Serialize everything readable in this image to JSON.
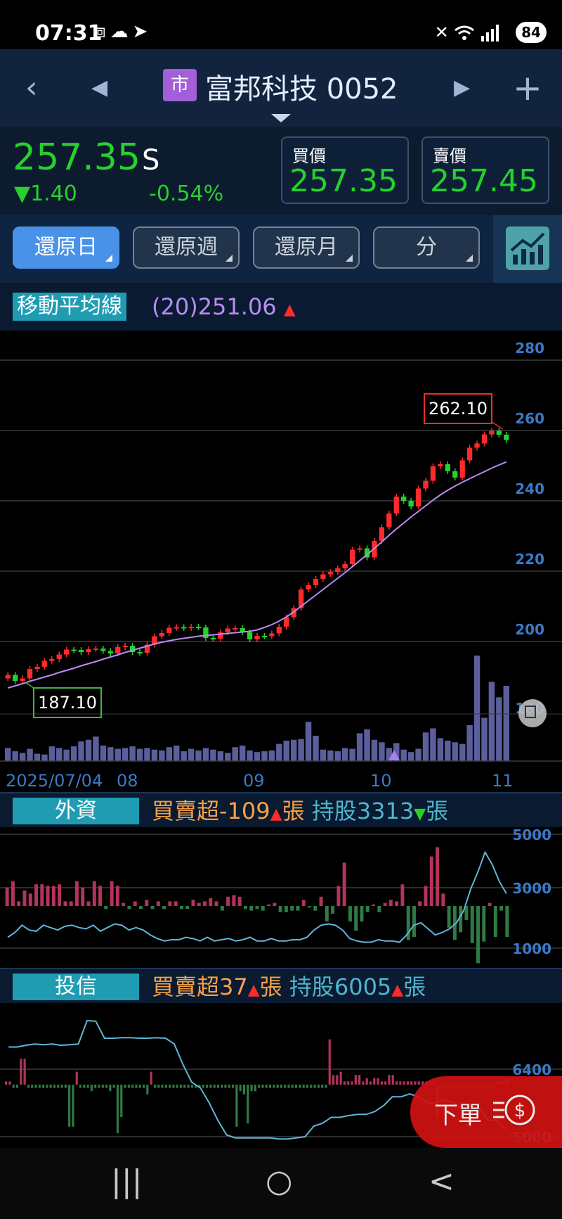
{
  "status_bar": {
    "time": "07:31",
    "left_icons": [
      "screenshot-icon",
      "cloud-icon",
      "navigation-icon"
    ],
    "right_icons": [
      "mute-icon",
      "wifi-icon",
      "signal-icon"
    ],
    "battery": "84"
  },
  "header": {
    "market_badge": "市",
    "title": "富邦科技 0052",
    "back_icon": "back-icon",
    "prev_icon": "prev-stock-icon",
    "next_icon": "next-stock-icon",
    "add_icon": "add-icon"
  },
  "quote": {
    "price": "257.35",
    "price_suffix": "S",
    "change": "▼1.40",
    "change_pct": "-0.54%",
    "bid_label": "買價",
    "bid": "257.35",
    "ask_label": "賣價",
    "ask": "257.45",
    "price_color": "#27d12b"
  },
  "periods": [
    {
      "label": "還原日",
      "active": true
    },
    {
      "label": "還原週",
      "active": false
    },
    {
      "label": "還原月",
      "active": false
    },
    {
      "label": "分",
      "active": false
    }
  ],
  "moving_average": {
    "label": "移動平均線",
    "value": "(20)251.06",
    "arrow": "▲",
    "line_color": "#b88cf2"
  },
  "chart_data": [
    {
      "type": "candlestick",
      "y_ticks": [
        "280",
        "260",
        "240",
        "220",
        "200"
      ],
      "ylim": [
        175,
        285
      ],
      "high_label": "262.10",
      "low_label": "187.10",
      "partial_tick": "180",
      "x_labels": [
        "2025/07/04",
        "08",
        "09",
        "10",
        "11"
      ],
      "up_color": "#ff2b2b",
      "down_color": "#27d12b",
      "close": [
        190.5,
        188.8,
        189.5,
        192.2,
        192.8,
        194.5,
        195.0,
        196.3,
        197.7,
        197.6,
        197.0,
        197.8,
        198.0,
        197.3,
        196.6,
        198.4,
        198.8,
        197.0,
        196.8,
        199.1,
        201.5,
        202.4,
        203.9,
        204.1,
        203.8,
        204.2,
        204.0,
        201.0,
        200.8,
        202.6,
        203.7,
        203.8,
        202.6,
        200.6,
        201.6,
        201.5,
        202.3,
        204.2,
        206.9,
        209.5,
        214.8,
        216.0,
        217.8,
        219.1,
        219.8,
        220.8,
        222.0,
        226.1,
        226.5,
        223.9,
        228.6,
        232.5,
        236.4,
        241.2,
        240.0,
        238.4,
        243.5,
        245.7,
        249.8,
        250.4,
        248.4,
        246.6,
        251.5,
        255.1,
        256.3,
        258.9,
        259.9,
        258.8,
        257.3
      ],
      "ma20": [
        186.8,
        187.4,
        188.0,
        188.7,
        189.3,
        189.9,
        190.5,
        191.2,
        191.8,
        192.4,
        193.1,
        193.7,
        194.3,
        195.0,
        195.6,
        196.2,
        196.9,
        197.5,
        198.1,
        198.7,
        199.3,
        199.8,
        200.2,
        200.6,
        200.9,
        201.2,
        201.5,
        201.7,
        201.9,
        202.1,
        202.3,
        202.5,
        202.7,
        202.9,
        203.3,
        204.0,
        204.8,
        205.8,
        207.0,
        208.4,
        210.0,
        211.6,
        213.2,
        214.8,
        216.4,
        218.0,
        219.6,
        221.3,
        223.0,
        224.7,
        226.5,
        228.3,
        230.2,
        232.0,
        233.7,
        235.4,
        237.0,
        238.6,
        240.2,
        241.7,
        243.0,
        244.2,
        245.3,
        246.3,
        247.3,
        248.3,
        249.3,
        250.2,
        251.06
      ],
      "volume": [
        1.6,
        1.2,
        1.0,
        1.5,
        0.9,
        0.8,
        1.8,
        1.6,
        1.4,
        1.8,
        2.4,
        2.6,
        3.0,
        1.9,
        1.7,
        1.5,
        1.6,
        1.8,
        1.5,
        1.6,
        1.4,
        1.3,
        1.7,
        1.9,
        1.2,
        1.5,
        1.3,
        1.6,
        1.4,
        1.2,
        1.0,
        1.7,
        1.9,
        1.3,
        1.1,
        1.2,
        1.3,
        2.1,
        2.5,
        2.6,
        2.7,
        4.8,
        3.1,
        1.4,
        1.3,
        1.2,
        1.6,
        1.5,
        3.4,
        3.9,
        2.6,
        2.3,
        1.6,
        2.2,
        1.4,
        1.1,
        1.5,
        3.5,
        4.0,
        2.8,
        2.5,
        2.3,
        2.1,
        4.4,
        12.9,
        5.3,
        9.7,
        7.8,
        9.2
      ]
    },
    {
      "type": "bar+line",
      "name": "外資",
      "y_ticks": [
        "5000",
        "3000",
        "1000"
      ],
      "ylim": [
        0,
        5500
      ],
      "bars": [
        12,
        16,
        3,
        10,
        8,
        14,
        14,
        13,
        13,
        14,
        3,
        3,
        16,
        12,
        3,
        16,
        13,
        -2,
        16,
        13,
        2,
        -2,
        3,
        -2,
        4,
        -2,
        3,
        -2,
        3,
        3,
        -2,
        -2,
        4,
        2,
        3,
        5,
        3,
        -3,
        6,
        7,
        6,
        -2,
        -3,
        -2,
        -3,
        1,
        2,
        -4,
        -4,
        -3,
        -3,
        4,
        -1,
        -3,
        6,
        -10,
        -5,
        13,
        28,
        -10,
        -16,
        -10,
        -4,
        1,
        -4,
        2,
        4,
        3,
        14,
        -22,
        -20,
        3,
        13,
        32,
        38,
        8,
        -14,
        -22,
        -17,
        -9,
        -24,
        -37,
        -23,
        2,
        -20,
        -3,
        -20
      ],
      "holdings": [
        1200,
        1400,
        1700,
        1500,
        1450,
        1700,
        1600,
        1500,
        1650,
        1700,
        1600,
        1550,
        1700,
        1450,
        1600,
        1750,
        1700,
        1500,
        1600,
        1500,
        1300,
        1150,
        1050,
        1100,
        1100,
        1200,
        1150,
        1050,
        1200,
        1050,
        1100,
        1150,
        1050,
        1100,
        1200,
        1050,
        1050,
        1150,
        1050,
        1050,
        1100,
        1100,
        1200,
        1500,
        1700,
        1750,
        1700,
        1500,
        1150,
        1050,
        1000,
        1000,
        1100,
        1050,
        1050,
        1000,
        1300,
        1700,
        1800,
        1550,
        1300,
        1400,
        1550,
        1800,
        2300,
        3200,
        3900,
        4700,
        4200,
        3500,
        3000
      ]
    },
    {
      "type": "bar+line",
      "name": "投信",
      "y_ticks": [
        "6400",
        "5000"
      ],
      "ylim": [
        4800,
        7200
      ],
      "bars": [
        1,
        1,
        -1,
        -1,
        8,
        8,
        -1,
        -1,
        -1,
        -1,
        -1,
        -1,
        -1,
        -1,
        -1,
        -1,
        -1,
        -13,
        -13,
        4,
        -1,
        -1,
        -1,
        -2,
        -1,
        -1,
        -1,
        -1,
        -2,
        -1,
        -15,
        -10,
        -1,
        -1,
        -1,
        -1,
        -1,
        -1,
        -3,
        4,
        -1,
        -1,
        -1,
        -1,
        -1,
        -1,
        -1,
        -1,
        -1,
        -1,
        -1,
        -1,
        -1,
        -1,
        -1,
        -1,
        -1,
        -1,
        -1,
        -1,
        -1,
        -1,
        -13,
        -2,
        -3,
        -12,
        -2,
        -2,
        -1,
        -1,
        -1,
        -1,
        -1,
        -1,
        -1,
        -1,
        -1,
        -1,
        -1,
        -1,
        -1,
        -1,
        -1,
        -1,
        -1,
        -1,
        -1,
        14,
        3,
        3,
        4,
        1,
        1,
        1,
        3,
        3,
        1,
        2,
        1,
        2,
        2,
        1,
        1,
        3,
        3,
        1,
        1,
        1,
        1,
        1,
        1,
        1,
        1,
        1,
        1,
        1,
        -10,
        -1,
        -1,
        -1,
        -1,
        -1,
        -1,
        -1,
        -1,
        -1,
        -1,
        -1,
        -1,
        -1,
        -1,
        -1,
        1,
        1,
        1,
        2
      ],
      "holdings": [
        6450,
        6450,
        6480,
        6500,
        6490,
        6500,
        6480,
        6490,
        6500,
        6900,
        6890,
        6600,
        6600,
        6610,
        6610,
        6600,
        6600,
        6610,
        6600,
        6500,
        6150,
        5850,
        5750,
        5500,
        5200,
        4950,
        4900,
        4900,
        4900,
        4900,
        4900,
        4880,
        4880,
        4900,
        4920,
        5100,
        5150,
        5250,
        5250,
        5280,
        5300,
        5300,
        5350,
        5450,
        5600,
        5600,
        5650,
        5600,
        5500,
        5500,
        5550,
        5500,
        5400,
        5400,
        5400,
        5200,
        5200,
        5050
      ]
    }
  ],
  "foreign_investor": {
    "tag": "外資",
    "net_label": "買賣超-109",
    "net_arrow": "▲",
    "net_unit": "張",
    "hold_label": "持股3313",
    "hold_arrow": "▼",
    "hold_unit": "張"
  },
  "investment_trust": {
    "tag": "投信",
    "net_label": "買賣超37",
    "net_arrow": "▲",
    "net_unit": "張",
    "hold_label": "持股6005",
    "hold_arrow": "▲",
    "hold_unit": "張"
  },
  "order_button": {
    "label": "下單",
    "icon": "dollar-icon"
  },
  "nav_bar": {
    "recents": "|||",
    "home": "○",
    "back": "<"
  }
}
